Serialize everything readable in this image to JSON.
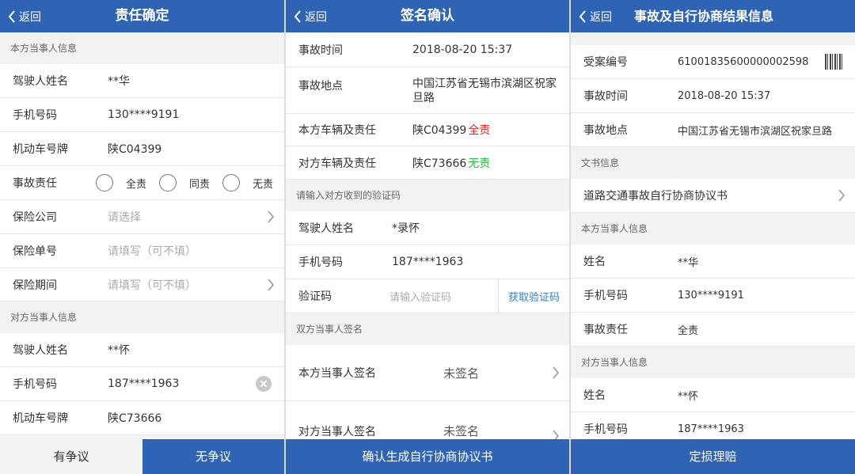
{
  "common": {
    "back_label": "返回"
  },
  "screen1": {
    "title": "责任确定",
    "section_self": "本方当事人信息",
    "section_other": "对方当事人信息",
    "self_rows": [
      {
        "label": "驾驶人姓名",
        "value": "**华"
      },
      {
        "label": "手机号码",
        "value": "130****9191"
      },
      {
        "label": "机动车号牌",
        "value": "陕C04399"
      }
    ],
    "liability": {
      "label": "事故责任",
      "options": [
        "全责",
        "同责",
        "无责"
      ]
    },
    "insurance_company": {
      "label": "保险公司",
      "placeholder": "请选择"
    },
    "policy_number": {
      "label": "保险单号",
      "placeholder": "请填写（可不填）"
    },
    "policy_period": {
      "label": "保险期间",
      "placeholder": "请填写（可不填）"
    },
    "other_rows": [
      {
        "label": "驾驶人姓名",
        "value": "**怀"
      },
      {
        "label": "手机号码",
        "value": "187****1963"
      },
      {
        "label": "机动车号牌",
        "value": "陕C73666"
      }
    ],
    "btn_dispute": "有争议",
    "btn_no_dispute": "无争议"
  },
  "screen2": {
    "title": "签名确认",
    "accident_time": {
      "label": "事故时间",
      "value": "2018-08-20 15:37"
    },
    "accident_place": {
      "label": "事故地点",
      "value_line1": "中国江苏省无锡市滨湖区祝家",
      "value_line2": "旦路"
    },
    "self_vehicle": {
      "label": "本方车辆及责任",
      "plate": "陕C04399",
      "liability": "全责"
    },
    "other_vehicle": {
      "label": "对方车辆及责任",
      "plate": "陕C73666",
      "liability": "无责"
    },
    "section_code": "请输入对方收到的验证码",
    "driver": {
      "label": "驾驶人姓名",
      "value": "*录怀"
    },
    "phone": {
      "label": "手机号码",
      "value": "187****1963"
    },
    "code": {
      "label": "验证码",
      "placeholder": "请输入验证码",
      "link": "获取验证码"
    },
    "section_sign": "双方当事人签名",
    "self_sign": {
      "label": "本方当事人签名",
      "value": "未签名"
    },
    "other_sign": {
      "label": "对方当事人签名",
      "value": "未签名"
    },
    "btn_generate": "确认生成自行协商协议书"
  },
  "screen3": {
    "title": "事故及自行协商结果信息",
    "case_no": {
      "label": "受案编号",
      "value": "61001835600000002598"
    },
    "accident_time": {
      "label": "事故时间",
      "value": "2018-08-20 15:37"
    },
    "accident_place": {
      "label": "事故地点",
      "value": "中国江苏省无锡市滨湖区祝家旦路"
    },
    "section_docs": "文书信息",
    "doc": {
      "label": "道路交通事故自行协商协议书"
    },
    "section_self": "本方当事人信息",
    "self_name": {
      "label": "姓名",
      "value": "**华"
    },
    "self_phone": {
      "label": "手机号码",
      "value": "130****9191"
    },
    "self_liability": {
      "label": "事故责任",
      "value": "全责"
    },
    "section_other": "对方当事人信息",
    "other_name": {
      "label": "姓名",
      "value": "**怀"
    },
    "other_phone": {
      "label": "手机号码",
      "value": "187****1963"
    },
    "btn_claim": "定损理赔"
  },
  "colors": {
    "header": "#2f64b4",
    "red": "#e8231e",
    "green": "#1fbf3c",
    "link": "#2f7fd6"
  }
}
